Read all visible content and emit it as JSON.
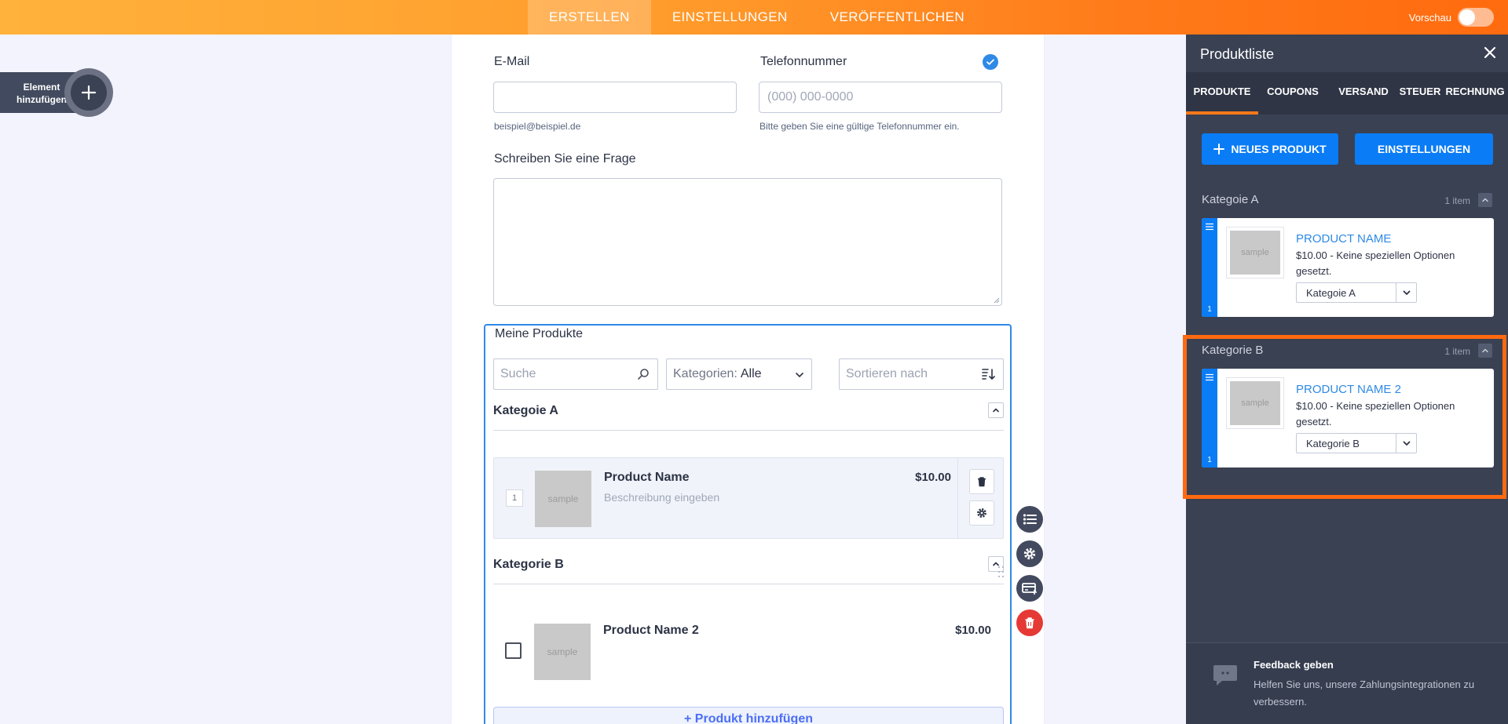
{
  "topbar": {
    "tabs": [
      {
        "label": "ERSTELLEN",
        "active": true
      },
      {
        "label": "EINSTELLUNGEN",
        "active": false
      },
      {
        "label": "VERÖFFENTLICHEN",
        "active": false
      }
    ],
    "preview_label": "Vorschau",
    "preview_on": false
  },
  "add_element": {
    "line1": "Element",
    "line2": "hinzufügen"
  },
  "form": {
    "email": {
      "label": "E-Mail",
      "value": "",
      "sublabel": "beispiel@beispiel.de"
    },
    "phone": {
      "label": "Telefonnummer",
      "placeholder": "(000) 000-0000",
      "sublabel": "Bitte geben Sie eine gültige Telefonnummer ein."
    },
    "question": {
      "label": "Schreiben Sie eine Frage"
    }
  },
  "products_widget": {
    "title": "Meine Produkte",
    "search_placeholder": "Suche",
    "category_filter_label": "Kategorien:",
    "category_filter_value": "Alle",
    "sort_placeholder": "Sortieren nach",
    "categories": [
      {
        "name": "Kategoie A",
        "products": [
          {
            "name": "Product Name",
            "description": "Beschreibung eingeben",
            "price": "$10.00",
            "quantity": "1",
            "thumb": "sample"
          }
        ]
      },
      {
        "name": "Kategorie B",
        "products": [
          {
            "name": "Product Name 2",
            "description": "",
            "price": "$10.00",
            "thumb": "sample"
          }
        ]
      }
    ],
    "add_product_label": "+ Produkt hinzufügen"
  },
  "panel": {
    "title": "Produktliste",
    "tabs": [
      {
        "label": "PRODUKTE",
        "active": true
      },
      {
        "label": "COUPONS",
        "active": false
      },
      {
        "label": "VERSAND",
        "active": false
      },
      {
        "label": "STEUER",
        "active": false
      },
      {
        "label": "RECHNUNG",
        "active": false
      }
    ],
    "new_product_label": "NEUES PRODUKT",
    "settings_label": "EINSTELLUNGEN",
    "categories": [
      {
        "name": "Kategoie A",
        "count": "1 item",
        "product": {
          "name": "PRODUCT NAME",
          "desc": "$10.00 - Keine speziellen Optionen gesetzt.",
          "category": "Kategoie A",
          "order": "1",
          "thumb": "sample"
        }
      },
      {
        "name": "Kategorie B",
        "count": "1 item",
        "product": {
          "name": "PRODUCT NAME 2",
          "desc": "$10.00 - Keine speziellen Optionen gesetzt.",
          "category": "Kategorie B",
          "order": "1",
          "thumb": "sample"
        }
      }
    ],
    "feedback": {
      "title": "Feedback geben",
      "text": "Helfen Sie uns, unsere Zahlungsintegrationen zu verbessern."
    }
  },
  "colors": {
    "accent": "#ff7a1a",
    "primary_blue": "#0a7cf5",
    "highlight": "#ff6a10",
    "panel_bg": "#3a4153"
  }
}
